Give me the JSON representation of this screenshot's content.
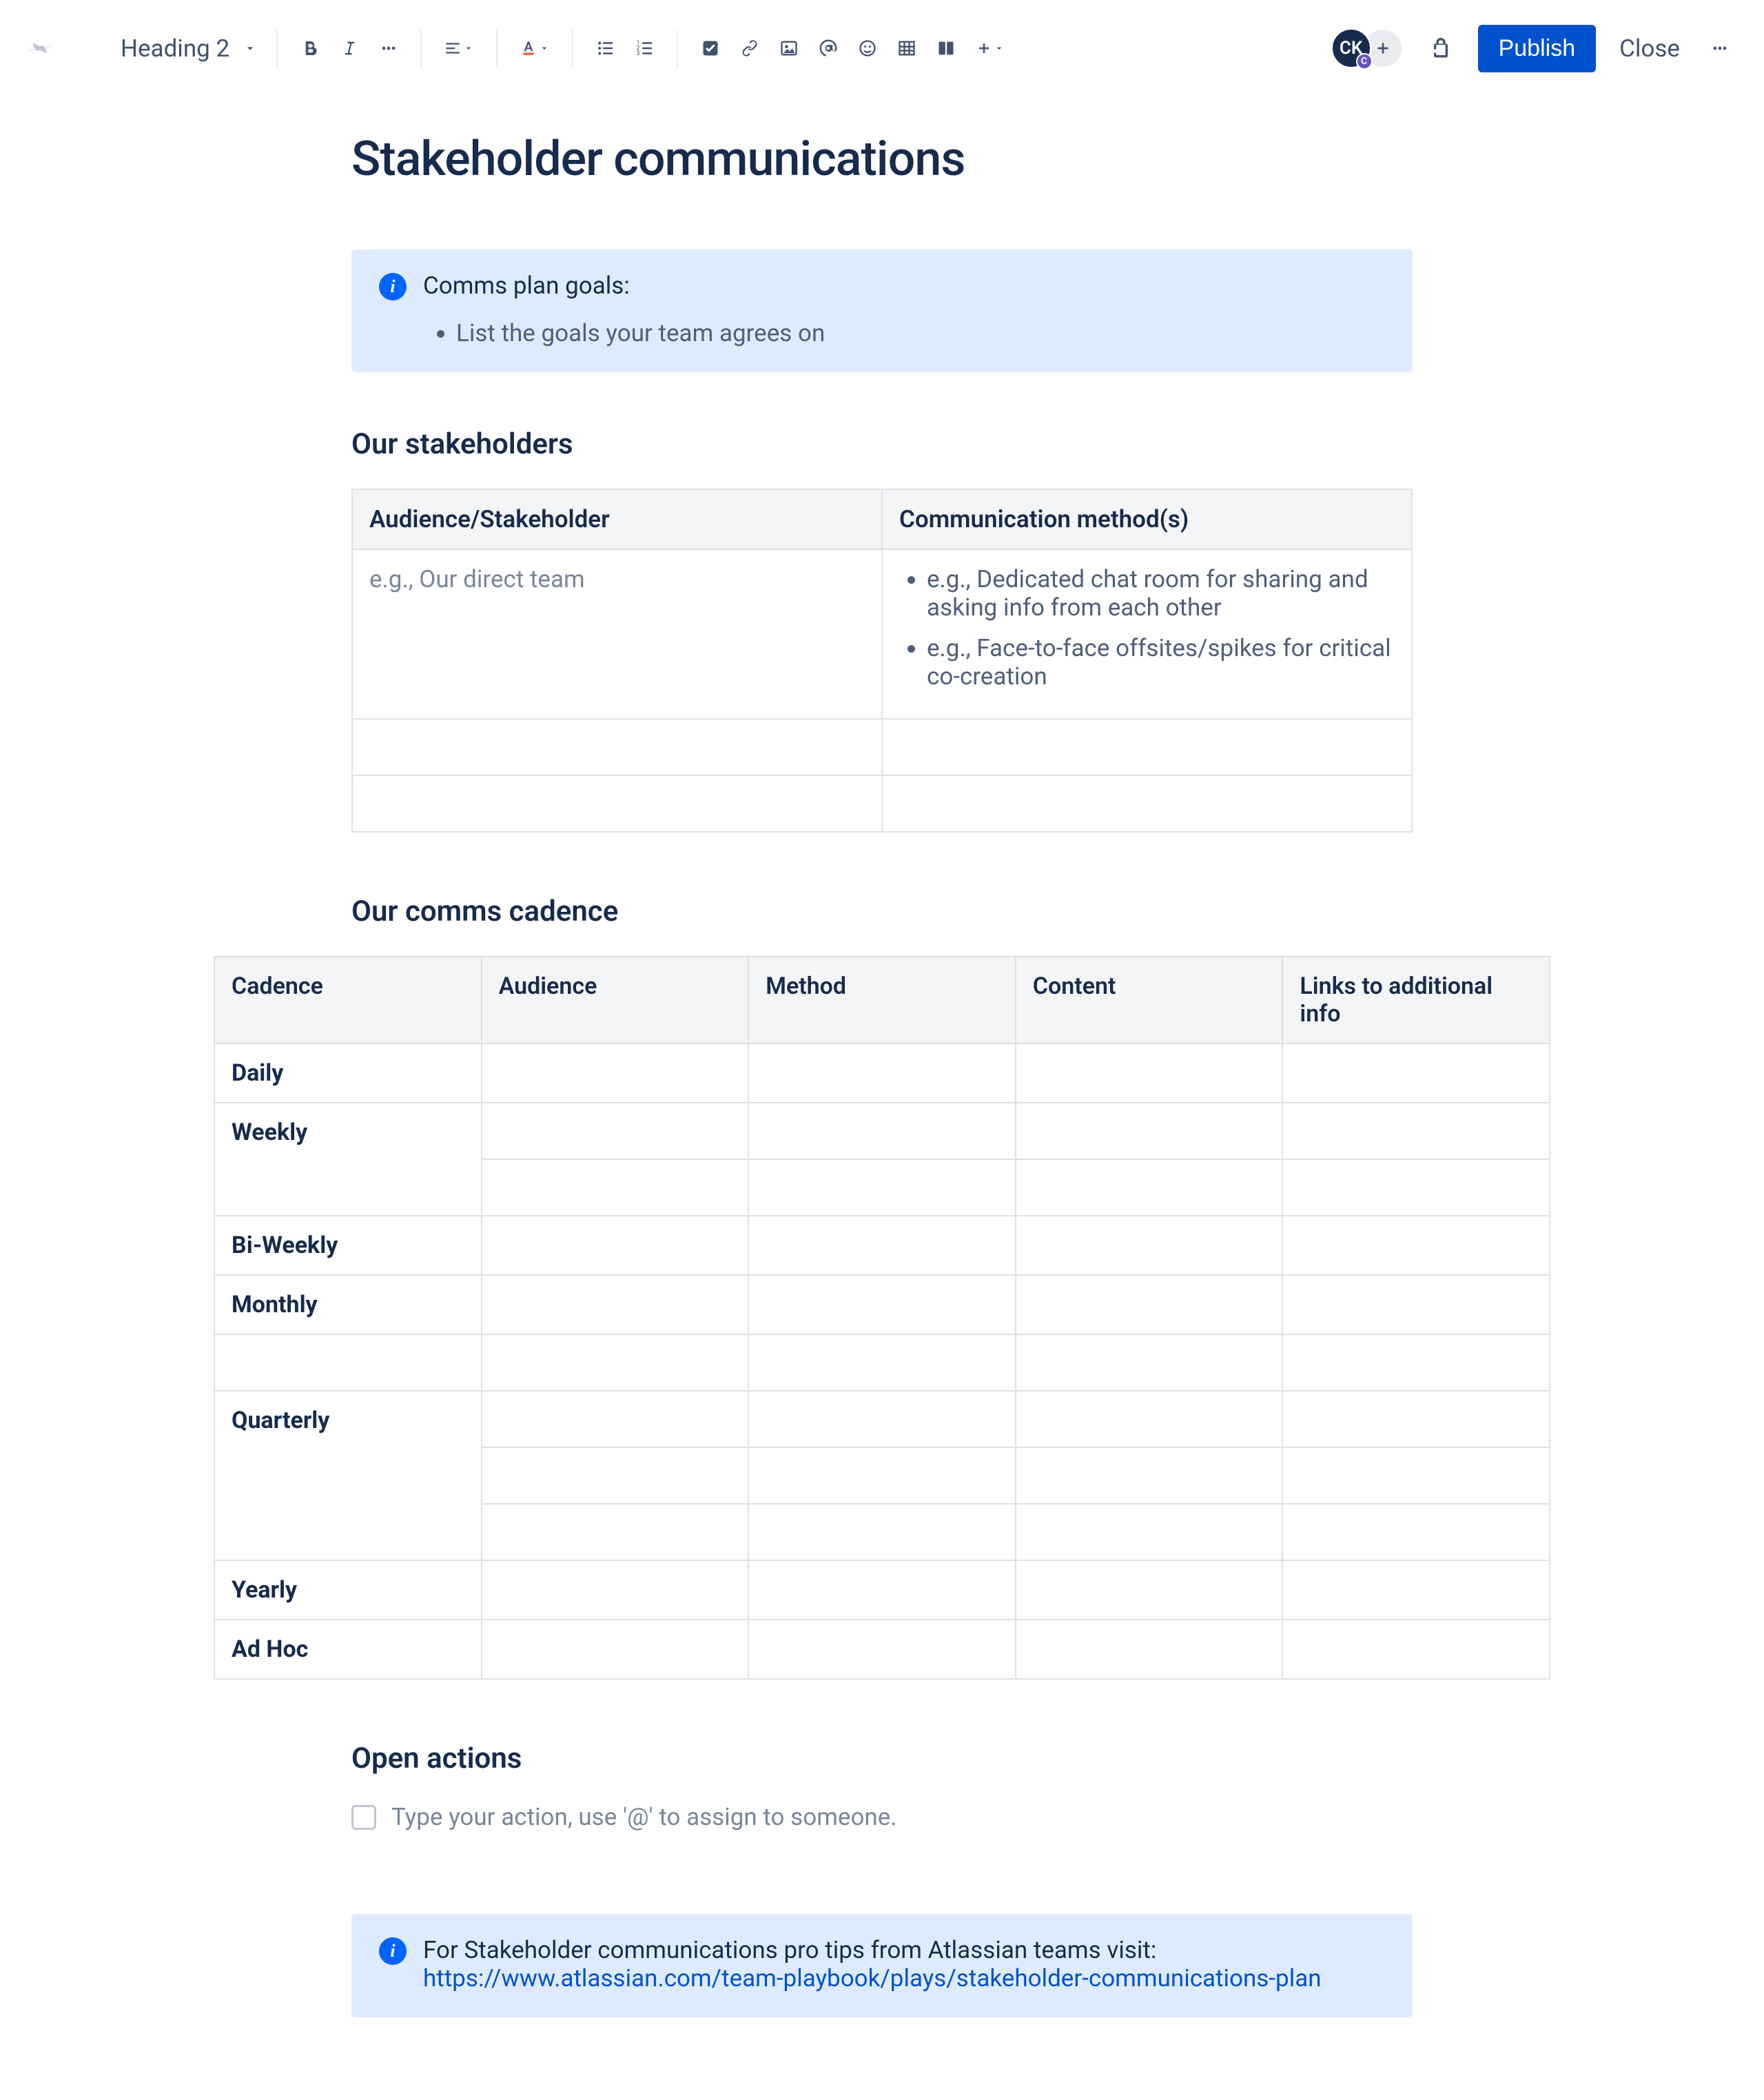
{
  "toolbar": {
    "heading_style": "Heading 2",
    "publish_label": "Publish",
    "close_label": "Close"
  },
  "user": {
    "avatar_initials": "CK",
    "avatar_badge": "C"
  },
  "page_title": "Stakeholder communications",
  "goals_panel": {
    "title": "Comms plan goals:",
    "items": [
      "List the goals your team agrees on"
    ]
  },
  "stakeholders": {
    "heading": "Our stakeholders",
    "columns": [
      "Audience/Stakeholder",
      "Communication method(s)"
    ],
    "rows": [
      {
        "audience": "e.g., Our direct team",
        "methods": [
          "e.g., Dedicated chat room for sharing and asking info from each other",
          "e.g., Face-to-face offsites/spikes for critical co-creation"
        ]
      }
    ]
  },
  "cadence": {
    "heading": "Our comms cadence",
    "columns": [
      "Cadence",
      "Audience",
      "Method",
      "Content",
      "Links to additional info"
    ],
    "row_labels": [
      "Daily",
      "Weekly",
      "Bi-Weekly",
      "Monthly",
      "",
      "Quarterly",
      "Yearly",
      "Ad Hoc"
    ]
  },
  "open_actions": {
    "heading": "Open actions",
    "placeholder": "Type your action, use '@' to assign to someone."
  },
  "footer_panel": {
    "prefix": "For Stakeholder communications pro tips from Atlassian teams visit: ",
    "link_text": "https://www.atlassian.com/team-playbook/plays/stakeholder-communications-plan"
  }
}
